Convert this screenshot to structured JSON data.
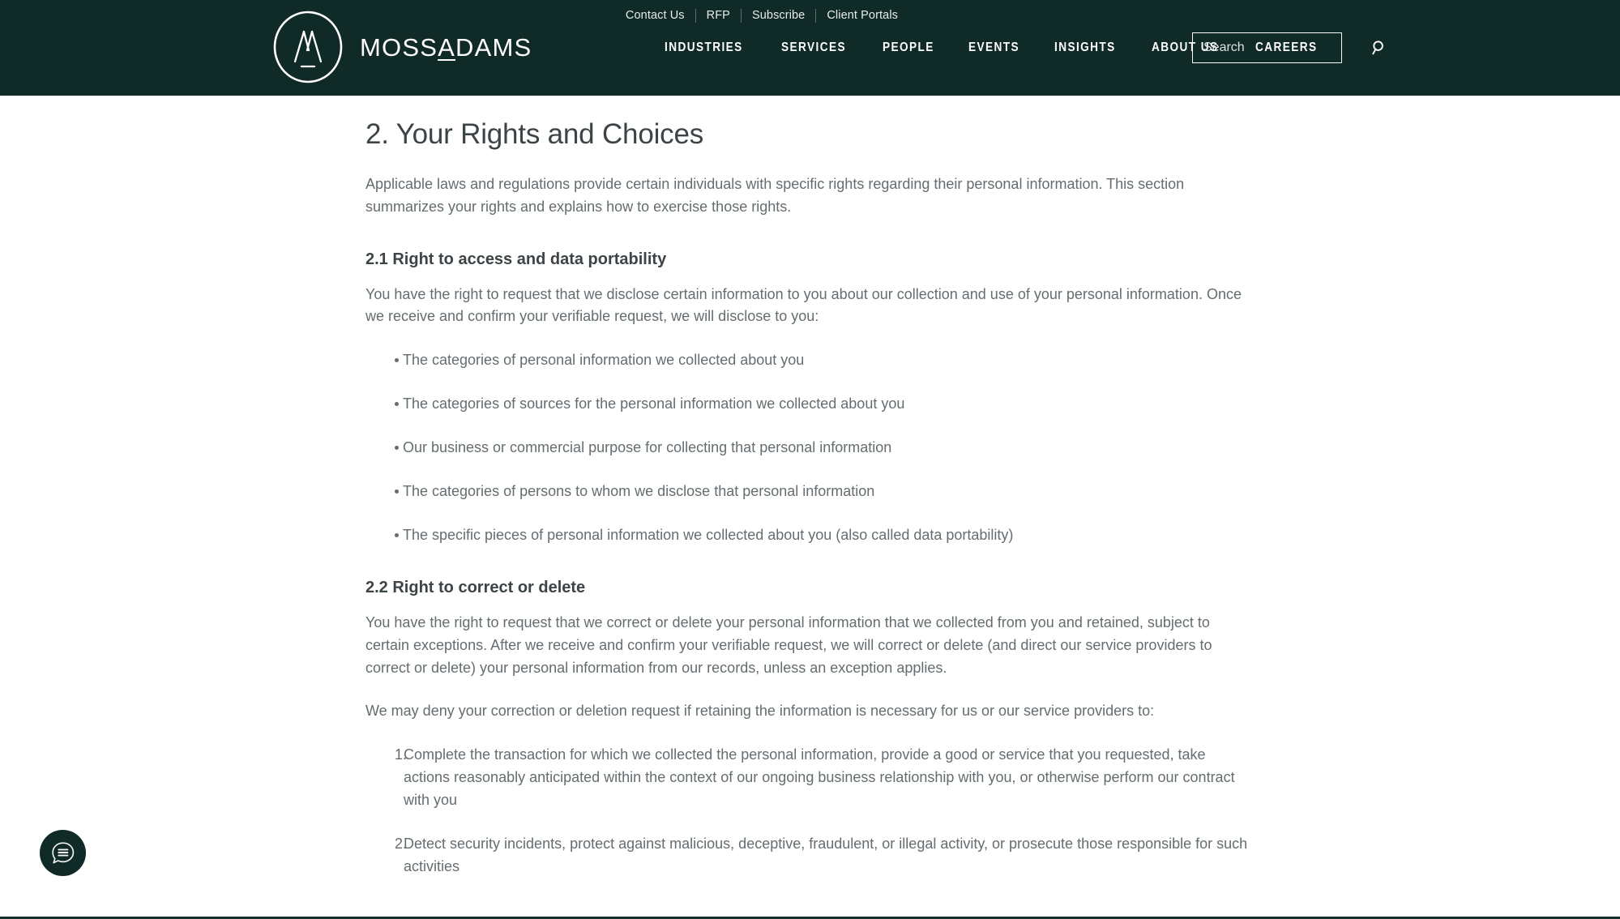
{
  "theme": {
    "header_bg": "#0f2a27",
    "page_bg": "#ffffff",
    "heading_color": "#3c4447",
    "body_color": "#646d70",
    "accent": "#0f2a27"
  },
  "header": {
    "logo": {
      "mark_name": "moss-adams-circle-mountain-logo",
      "text_part1": "MOSS",
      "text_underlined": "A",
      "text_part2": "DAMS",
      "full_text": "MOSSADAMS"
    },
    "utility_links": [
      {
        "label": "Contact Us"
      },
      {
        "label": "RFP"
      },
      {
        "label": "Subscribe"
      },
      {
        "label": "Client Portals"
      }
    ],
    "nav_links": [
      {
        "label": "INDUSTRIES"
      },
      {
        "label": "SERVICES"
      },
      {
        "label": "PEOPLE"
      },
      {
        "label": "EVENTS"
      },
      {
        "label": "INSIGHTS"
      },
      {
        "label": "ABOUT US"
      },
      {
        "label": "CAREERS"
      }
    ],
    "search": {
      "placeholder": "Search",
      "value": "",
      "icon": "search-icon"
    }
  },
  "main": {
    "section_title": "2. Your Rights and Choices",
    "intro_paragraph": "Applicable laws and regulations provide certain individuals with specific rights regarding their personal information. This section summarizes your rights and explains how to exercise those rights.",
    "subsection_1": {
      "title": "2.1 Right to access and data portability",
      "paragraph": "You have the right to request that we disclose certain information to you about our collection and use of your personal information. Once we receive and confirm your verifiable request, we will disclose to you:",
      "bullets": [
        "The categories of personal information we collected about you",
        "The categories of sources for the personal information we collected about you",
        "Our business or commercial purpose for collecting that personal information",
        "The categories of persons to whom we disclose that personal information",
        "The specific pieces of personal information we collected about you (also called data portability)"
      ]
    },
    "subsection_2": {
      "title": "2.2 Right to correct or delete",
      "paragraph_1": "You have the right to request that we correct or delete your personal information that we collected from you and retained, subject to certain exceptions. After we receive and confirm your verifiable request, we will correct or delete (and direct our service providers to correct or delete) your personal information from our records, unless an exception applies.",
      "paragraph_2": "We may deny your correction or deletion request if retaining the information is necessary for us or our service providers to:",
      "numbered_items": [
        "Complete the transaction for which we collected the personal information, provide a good or service that you requested, take actions reasonably anticipated within the context of our ongoing business relationship with you, or otherwise perform our contract with you",
        "Detect security incidents, protect against malicious, deceptive, fraudulent, or illegal activity, or prosecute those responsible for such activities"
      ]
    }
  },
  "chat_widget": {
    "icon": "chat-bubble-icon",
    "label": ""
  }
}
